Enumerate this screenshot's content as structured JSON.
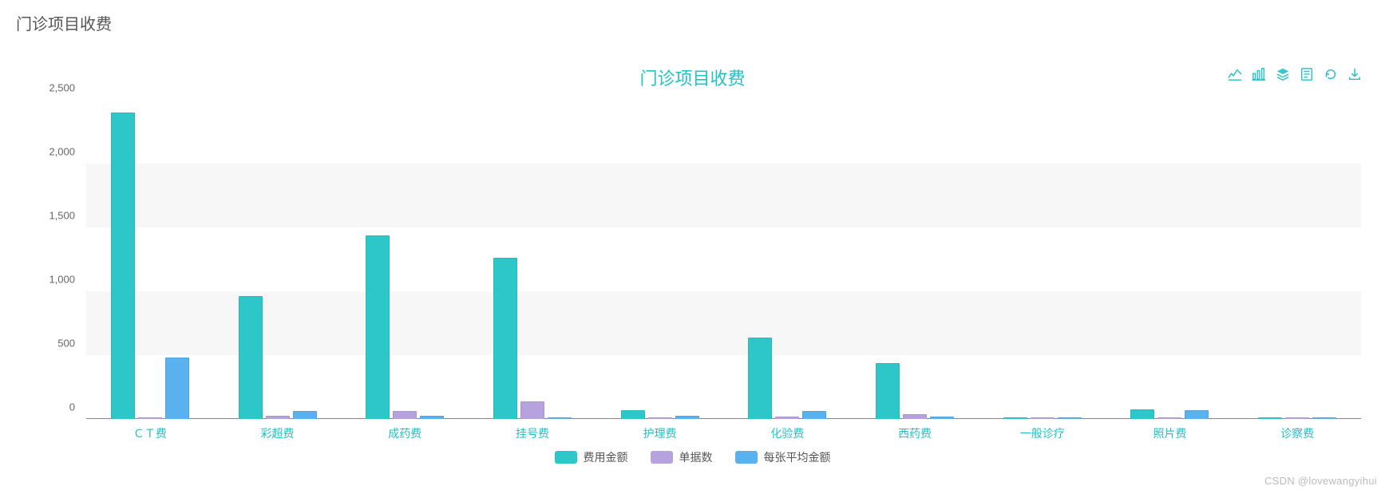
{
  "header": {
    "title": "门诊项目收费"
  },
  "chart_data": {
    "type": "bar",
    "title": "门诊项目收费",
    "xlabel": "",
    "ylabel": "",
    "ylim": [
      0,
      2500
    ],
    "yticks": [
      0,
      500,
      1000,
      1500,
      2000,
      2500
    ],
    "categories": [
      "ＣＴ费",
      "彩超费",
      "成药费",
      "挂号费",
      "护理费",
      "化验费",
      "西药费",
      "一般诊疗",
      "照片费",
      "诊察费"
    ],
    "series": [
      {
        "name": "费用金额",
        "color": "#2ec7c9",
        "values": [
          2400,
          960,
          1440,
          1260,
          70,
          635,
          440,
          10,
          75,
          10
        ]
      },
      {
        "name": "单据数",
        "color": "#b6a2de",
        "values": [
          10,
          25,
          65,
          140,
          10,
          20,
          35,
          15,
          10,
          10
        ]
      },
      {
        "name": "每张平均金额",
        "color": "#5ab1ef",
        "values": [
          480,
          60,
          25,
          10,
          25,
          65,
          20,
          10,
          70,
          10
        ]
      }
    ],
    "legend_position": "bottom",
    "grid": true
  },
  "toolbox": {
    "line": {
      "title": "切换为折线图"
    },
    "bar": {
      "title": "切换为柱状图"
    },
    "stack": {
      "title": "切换为堆叠"
    },
    "data": {
      "title": "数据视图"
    },
    "restore": {
      "title": "还原"
    },
    "save": {
      "title": "保存为图片"
    }
  },
  "watermark": "CSDN @lovewangyihui"
}
